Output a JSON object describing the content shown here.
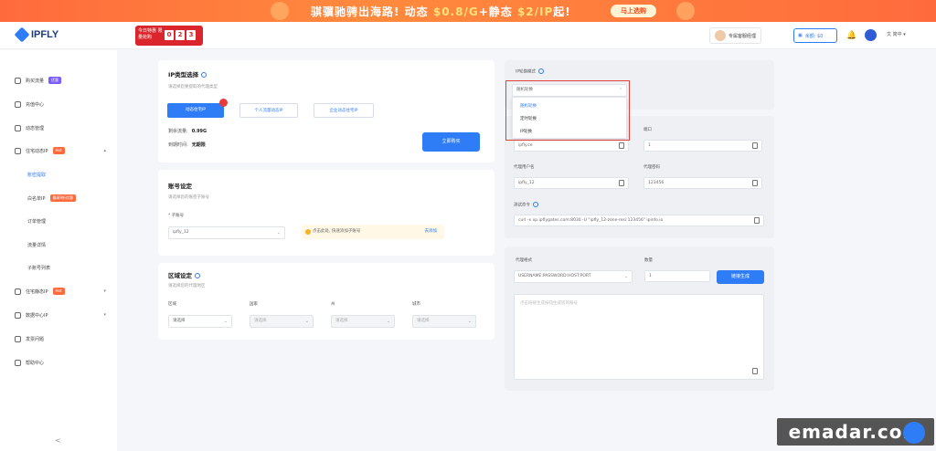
{
  "banner": {
    "text_main": "骐骥驰骋出海路! 动态",
    "price1": "$0.8/G",
    "plus": "+静态",
    "price2": "$2/IP",
    "tail": "起!",
    "cta": "马上选购"
  },
  "header": {
    "logo": "IPFLY",
    "promo_label": "今日特惠 限量抢购",
    "promo_digits": [
      "0",
      "2",
      "3"
    ],
    "service": "专属客服经理",
    "balance": "余额: $0",
    "lang": "简中"
  },
  "sidebar": {
    "items": [
      {
        "label": "购买流量",
        "tag": "优惠"
      },
      {
        "label": "充值中心"
      },
      {
        "label": "动态管理"
      },
      {
        "label": "住宅动态IP",
        "tag": "Hot"
      },
      {
        "label": "账密提取"
      },
      {
        "label": "白名单IP",
        "tag": "最高9折优惠"
      },
      {
        "label": "订单管理"
      },
      {
        "label": "流量详情"
      },
      {
        "label": "子账号列表"
      },
      {
        "label": "住宅静态IP",
        "tag": "Hot"
      },
      {
        "label": "数据中心IP"
      },
      {
        "label": "发票问题"
      },
      {
        "label": "帮助中心"
      }
    ],
    "collapse": "<"
  },
  "ip_type": {
    "title": "IP类型选择",
    "subtitle": "请选择您要提取的代理类型",
    "buttons": [
      "动态住宅IP",
      "个人流量动态IP",
      "企业动态住宅IP"
    ],
    "remaining_label": "剩余流量:",
    "remaining_value": "0.99G",
    "expire_label": "到期时间:",
    "expire_value": "无期限",
    "buy_btn": "立即购买"
  },
  "account": {
    "title": "账号设定",
    "subtitle": "请选择您的账密子账号",
    "field_label": "* 子账号",
    "field_value": "ipfly_12",
    "notice": "点击此处, 快速添加子账号",
    "notice_link": "去添加"
  },
  "region": {
    "title": "区域设定",
    "subtitle": "请选择您的代理地区",
    "fields": [
      {
        "label": "区域",
        "value": "请选择"
      },
      {
        "label": "国家",
        "value": "请选择"
      },
      {
        "label": "州",
        "value": "请选择"
      },
      {
        "label": "城市",
        "value": "请选择"
      }
    ]
  },
  "right": {
    "mode_label": "IP轮换模式",
    "mode_value": "随机轮换",
    "options": [
      "随机轮换",
      "定时轮换",
      "IP轮换"
    ],
    "host_label": "主机",
    "host_value": "ipfly.ce",
    "port_label": "端口",
    "port_value": "1",
    "user_label": "代理用户名",
    "user_value": "ipfly_12",
    "pwd_label": "代理密码",
    "pwd_value": "123456",
    "cmd_label": "测试命令",
    "cmd_value": "curl -x xp.ipflygates.com:8030 -U \"ipfly_12-zone-resi:123456\" ipinfo.io",
    "format_label": "代理格式",
    "format_value": "USERNAME:PASSWORD:HOST:PORT",
    "count_label": "数量",
    "count_value": "1",
    "generate_btn": "链接生成",
    "textarea_placeholder": "点击链接生成按钮生成您的账号"
  },
  "watermark": "emadar.com"
}
